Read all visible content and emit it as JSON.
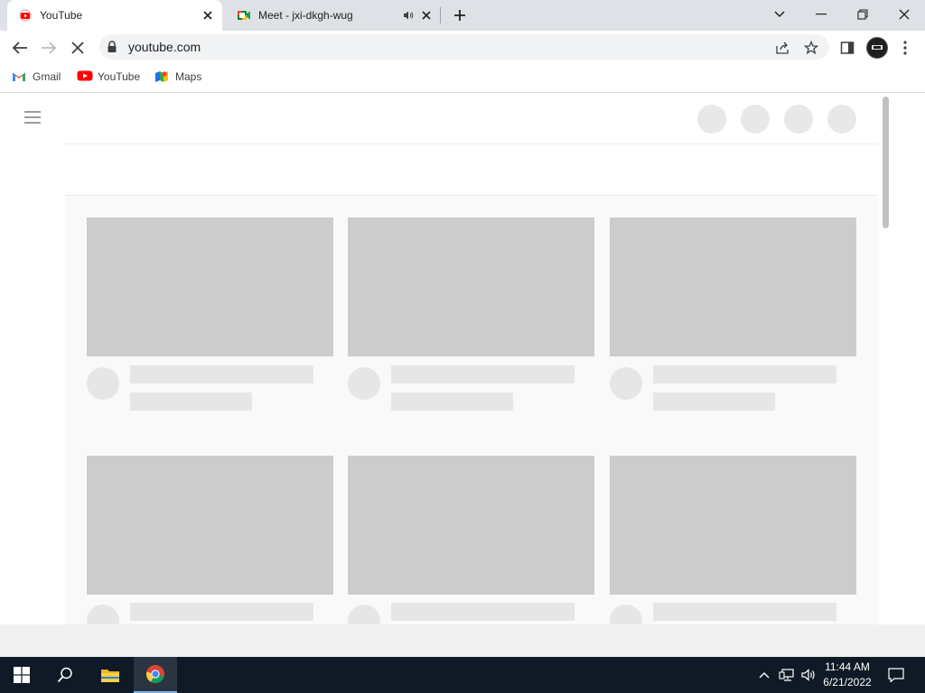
{
  "browser": {
    "tabs": [
      {
        "title": "YouTube",
        "active": true,
        "favicon": "youtube-icon"
      },
      {
        "title": "Meet - jxi-dkgh-wug",
        "active": false,
        "favicon": "google-meet-icon",
        "audio": true
      }
    ],
    "address": "youtube.com",
    "bookmarks": [
      {
        "label": "Gmail",
        "icon": "gmail-icon"
      },
      {
        "label": "YouTube",
        "icon": "youtube-icon"
      },
      {
        "label": "Maps",
        "icon": "maps-icon"
      }
    ],
    "loading": true
  },
  "colors": {
    "tab_strip": "#dee1e6",
    "skeleton_thumb": "#cccccc",
    "skeleton_text": "#e6e6e6",
    "taskbar": "#101a26",
    "youtube_red": "#ff0000"
  },
  "taskbar": {
    "time": "11:44 AM",
    "date": "6/21/2022",
    "pinned": [
      "windows-start-icon",
      "search-icon",
      "file-explorer-icon",
      "chrome-icon"
    ]
  }
}
